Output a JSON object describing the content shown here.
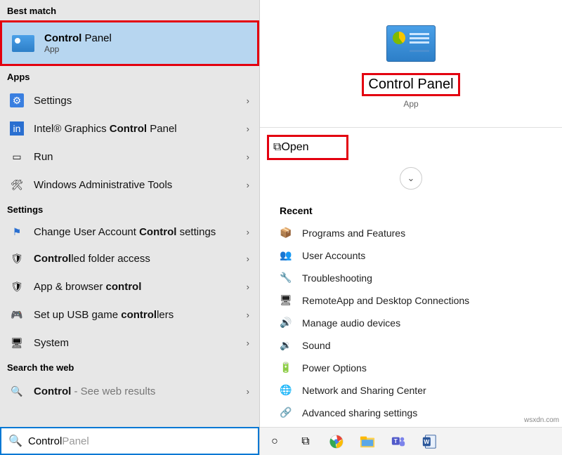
{
  "left": {
    "best_match_header": "Best match",
    "best_title_bold": "Control",
    "best_title_rest": " Panel",
    "best_sub": "App",
    "apps_header": "Apps",
    "apps": [
      {
        "label": "Settings"
      },
      {
        "label_pre": "Intel® Graphics ",
        "label_bold": "Control",
        "label_post": " Panel"
      },
      {
        "label": "Run"
      },
      {
        "label": "Windows Administrative Tools"
      }
    ],
    "settings_header": "Settings",
    "settings": [
      {
        "pre": "Change User Account ",
        "bold": "Control",
        "post": " settings"
      },
      {
        "bold": "Control",
        "post": "led folder access"
      },
      {
        "pre": "App & browser ",
        "bold": "control"
      },
      {
        "pre": "Set up USB game ",
        "bold": "control",
        "post": "lers"
      },
      {
        "label": "System"
      }
    ],
    "web_header": "Search the web",
    "web_bold": "Control",
    "web_post": " - See web results",
    "search_typed": "Control",
    "search_rest": " Panel"
  },
  "right": {
    "hero_title": "Control Panel",
    "hero_sub": "App",
    "open": "Open",
    "recent_header": "Recent",
    "recent": [
      "Programs and Features",
      "User Accounts",
      "Troubleshooting",
      "RemoteApp and Desktop Connections",
      "Manage audio devices",
      "Sound",
      "Power Options",
      "Network and Sharing Center",
      "Advanced sharing settings"
    ]
  },
  "watermark": "wsxdn.com"
}
